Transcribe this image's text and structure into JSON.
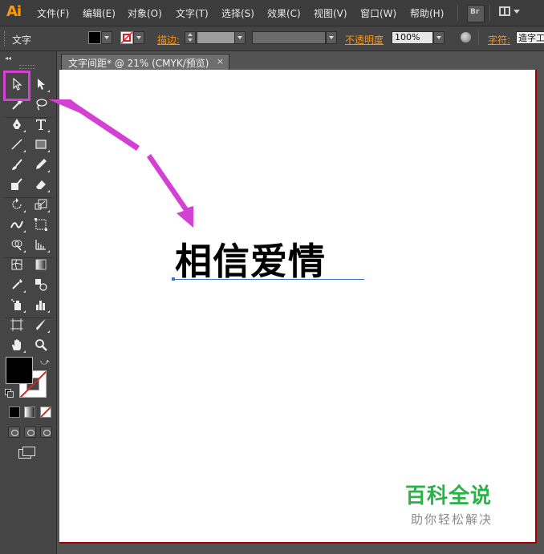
{
  "app": {
    "logo": "Ai"
  },
  "menu": [
    "文件(F)",
    "编辑(E)",
    "对象(O)",
    "文字(T)",
    "选择(S)",
    "效果(C)",
    "视图(V)",
    "窗口(W)",
    "帮助(H)"
  ],
  "menubar": {
    "bridge_label": "Br"
  },
  "control_bar": {
    "context_label": "文字",
    "stroke_label": "描边:",
    "opacity_label": "不透明度",
    "opacity_value": "100%",
    "character_label": "字符:",
    "character_value": "造字工"
  },
  "toolbox": {
    "collapse_glyph": "◂◂"
  },
  "document": {
    "tab_title": "文字间距* @ 21% (CMYK/预览)",
    "tab_close": "×",
    "text_content": "相信爱情"
  },
  "watermark": {
    "title": "百科全说",
    "subtitle": "助你轻松解决"
  },
  "colors": {
    "app_logo": "#ff9a00",
    "orange_label": "#f7941d",
    "highlight": "#d43fd4",
    "arrow": "#d43fd4",
    "watermark_green": "#2bb14a",
    "artboard_border": "#aa0000",
    "fill_color": "#000000",
    "stroke_none_slash": "#e02020"
  }
}
